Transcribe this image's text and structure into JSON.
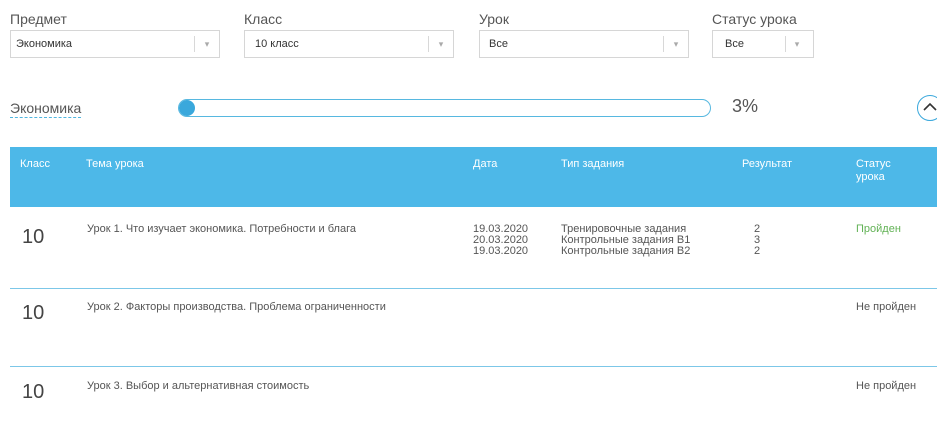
{
  "filters": [
    {
      "label": "Предмет",
      "value": "Экономика"
    },
    {
      "label": "Класс",
      "value": "10 класс"
    },
    {
      "label": "Урок",
      "value": "Все"
    },
    {
      "label": "Статус урока",
      "value": "Все"
    }
  ],
  "summary": {
    "subject": "Экономика",
    "progress_fraction": 0.03,
    "percent_text": "3%"
  },
  "table": {
    "headers": {
      "class": "Класс",
      "topic": "Тема урока",
      "date": "Дата",
      "task_type": "Тип задания",
      "result": "Результат",
      "status_line1": "Статус",
      "status_line2": "урока"
    },
    "rows": [
      {
        "class": "10",
        "topic": "Урок 1. Что изучает экономика. Потребности и блага",
        "entries": [
          {
            "date": "19.03.2020",
            "task_type": "Тренировочные задания",
            "result": "2"
          },
          {
            "date": "20.03.2020",
            "task_type": "Контрольные задания В1",
            "result": "3"
          },
          {
            "date": "19.03.2020",
            "task_type": "Контрольные задания В2",
            "result": "2"
          }
        ],
        "status": "Пройден"
      },
      {
        "class": "10",
        "topic": "Урок 2. Факторы производства. Проблема ограниченности",
        "entries": [],
        "status": "Не пройден"
      },
      {
        "class": "10",
        "topic": "Урок 3. Выбор и альтернативная стоимость",
        "entries": [],
        "status": "Не пройден"
      }
    ]
  },
  "colors": {
    "accent": "#4db8e8",
    "progress_fill": "#3aa8dc",
    "status_done": "#62b255"
  }
}
